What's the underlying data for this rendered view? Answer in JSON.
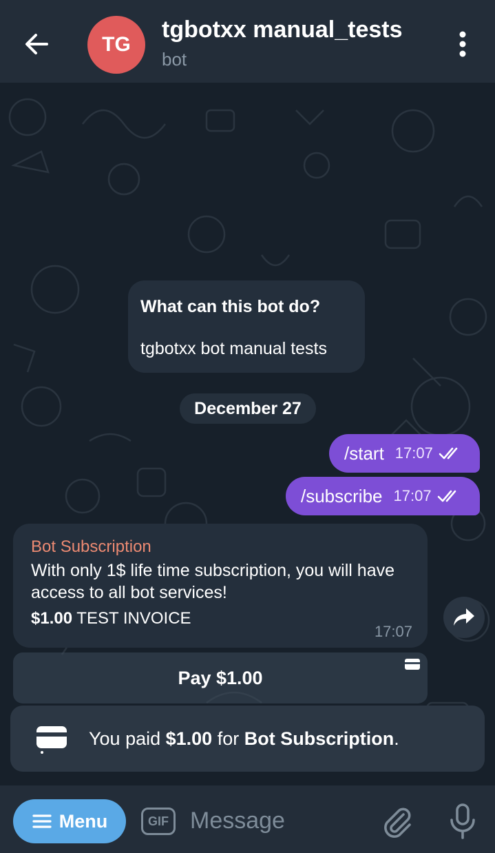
{
  "header": {
    "avatar_initials": "TG",
    "avatar_color": "#e05b5b",
    "title": "tgbotxx manual_tests",
    "subtitle": "bot",
    "back_icon": "arrow-left-icon",
    "menu_icon": "kebab-menu-icon"
  },
  "intro": {
    "question": "What can this bot do?",
    "description": "tgbotxx bot manual tests"
  },
  "date_separator": "December 27",
  "outgoing": [
    {
      "text": "/start",
      "time": "17:07"
    },
    {
      "text": "/subscribe",
      "time": "17:07"
    }
  ],
  "invoice": {
    "title": "Bot Subscription",
    "description": "With only 1$ life time subscription, you will have access to all bot services!",
    "amount": "$1.00",
    "label": "TEST INVOICE",
    "time": "17:07",
    "pay_button": "Pay $1.00"
  },
  "toast": {
    "prefix": "You paid ",
    "amount": "$1.00",
    "middle": " for ",
    "product": "Bot Subscription",
    "suffix": "."
  },
  "composer": {
    "menu_label": "Menu",
    "gif_label": "GIF",
    "placeholder": "Message"
  },
  "colors": {
    "accent_blue": "#5aa9e6",
    "outgoing_bubble": "#7d4ed6",
    "invoice_title": "#ec8a72"
  }
}
